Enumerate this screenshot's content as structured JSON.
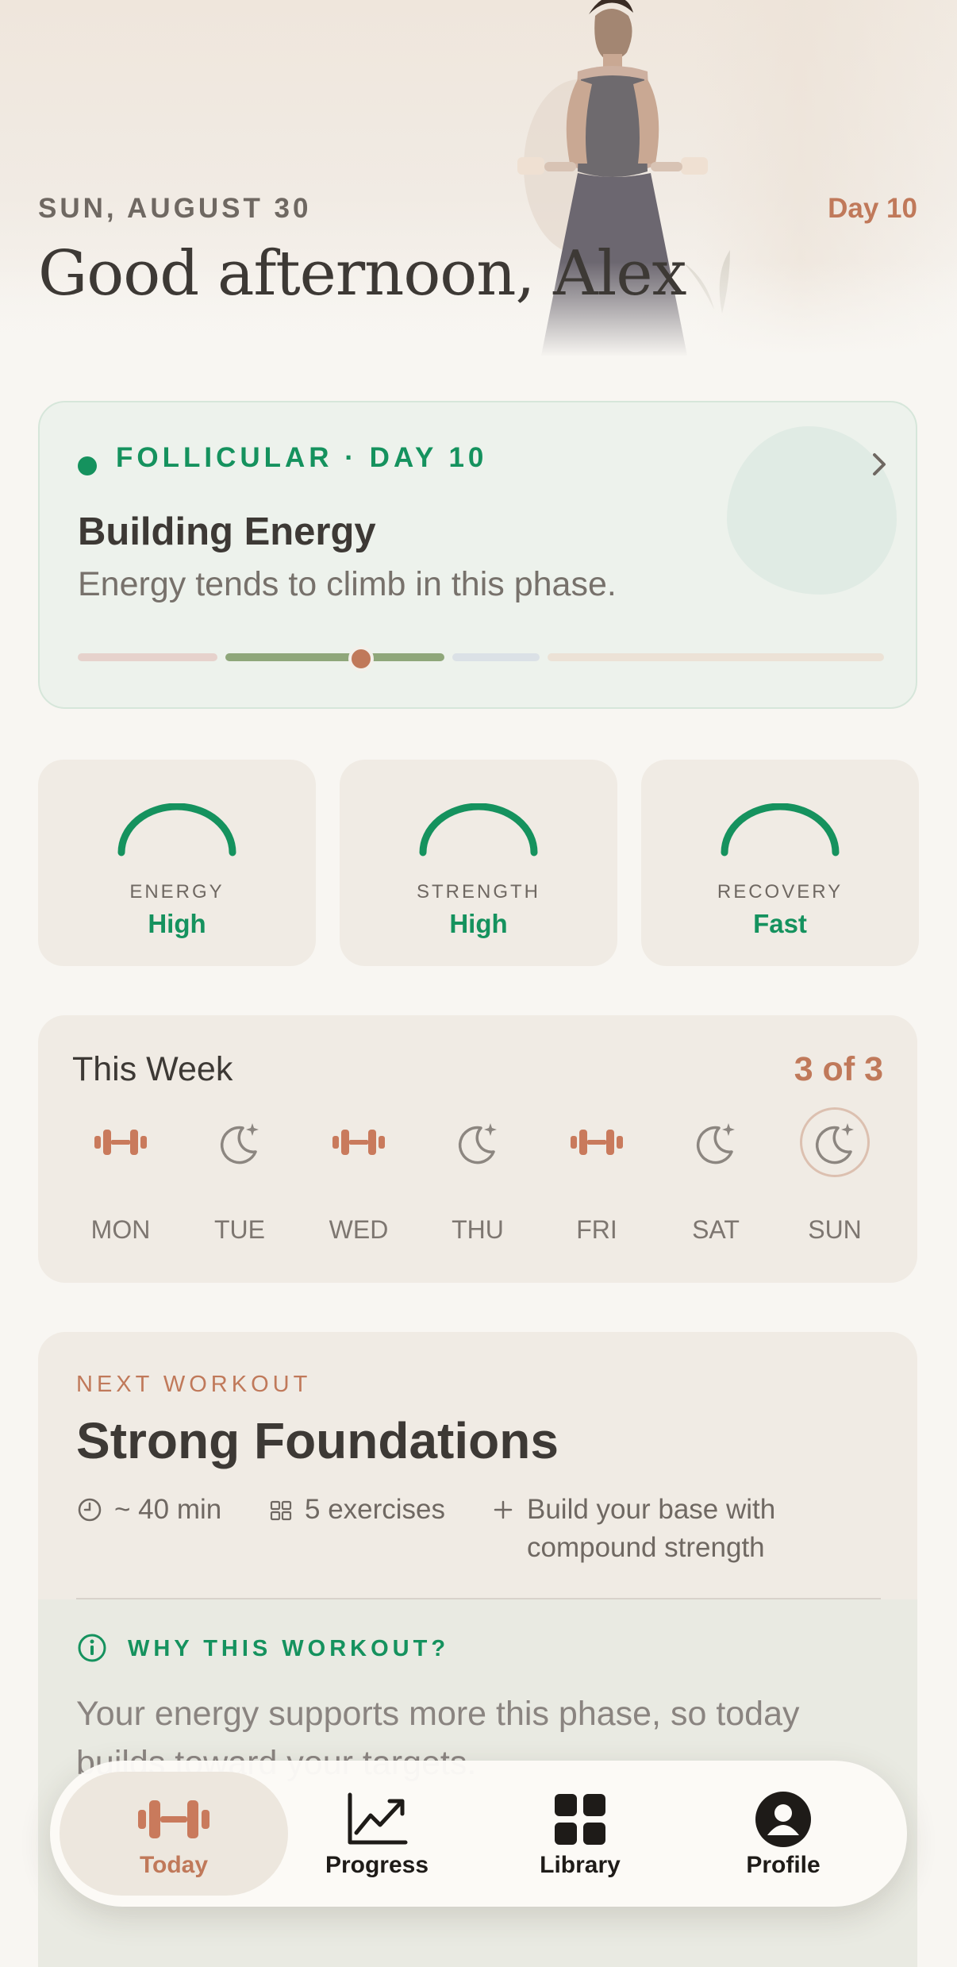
{
  "header": {
    "date": "SUN, AUGUST 30",
    "day_badge": "Day 10",
    "greeting": "Good afternoon, Alex"
  },
  "phase": {
    "tag": "FOLLICULAR · DAY 10",
    "title": "Building Energy",
    "subtitle": "Energy tends to climb in this phase.",
    "cycle_progress": 0.35
  },
  "stats": [
    {
      "label": "ENERGY",
      "value": "High"
    },
    {
      "label": "STRENGTH",
      "value": "High"
    },
    {
      "label": "RECOVERY",
      "value": "Fast"
    }
  ],
  "week": {
    "title": "This Week",
    "count": "3 of 3",
    "days": [
      {
        "label": "MON",
        "icon": "dumbbell-icon"
      },
      {
        "label": "TUE",
        "icon": "moon-icon"
      },
      {
        "label": "WED",
        "icon": "dumbbell-icon"
      },
      {
        "label": "THU",
        "icon": "moon-icon"
      },
      {
        "label": "FRI",
        "icon": "dumbbell-icon"
      },
      {
        "label": "SAT",
        "icon": "moon-icon"
      },
      {
        "label": "SUN",
        "icon": "moon-icon"
      }
    ]
  },
  "next_workout": {
    "tag": "NEXT WORKOUT",
    "title": "Strong Foundations",
    "duration": "~ 40 min",
    "exercises": "5 exercises",
    "focus_line1": "Build your base with",
    "focus_line2": "compound strength",
    "why_tag": "WHY THIS WORKOUT?",
    "why_text": "Your energy supports more this phase, so today builds toward your targets."
  },
  "tabs": [
    {
      "label": "Today",
      "icon": "dumbbell-icon"
    },
    {
      "label": "Progress",
      "icon": "chart-icon"
    },
    {
      "label": "Library",
      "icon": "grid-icon"
    },
    {
      "label": "Profile",
      "icon": "person-icon"
    }
  ],
  "colors": {
    "accent": "#c0795a",
    "green": "#15925e",
    "background": "#f8f6f2"
  }
}
